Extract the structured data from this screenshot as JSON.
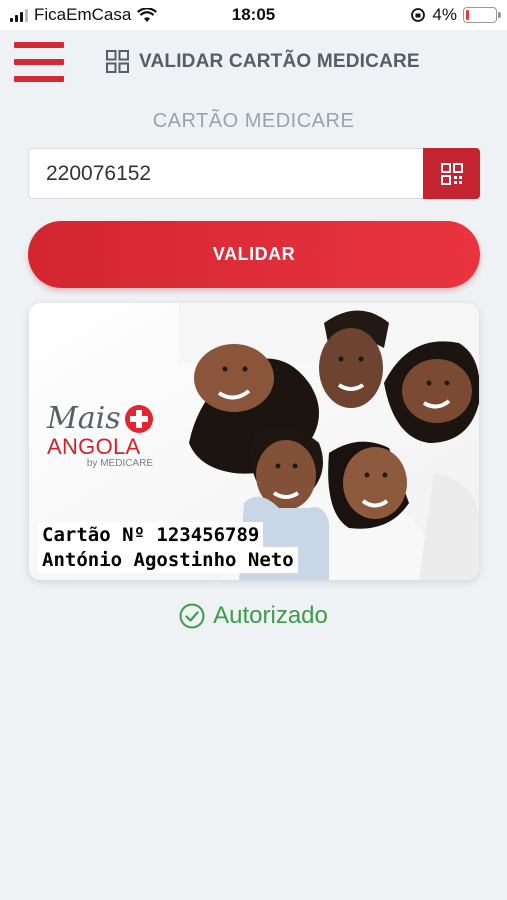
{
  "status_bar": {
    "carrier": "FicaEmCasa",
    "time": "18:05",
    "battery_percent": "4%",
    "battery_level": 0.04
  },
  "header": {
    "title": "VALIDAR CARTÃO MEDICARE",
    "icons": {
      "menu": "hamburger-menu-icon",
      "title": "qr-code-icon"
    }
  },
  "form": {
    "label": "CARTÃO MEDICARE",
    "card_number_value": "220076152",
    "scan_icon": "qr-scan-icon",
    "validate_label": "VALIDAR"
  },
  "card": {
    "brand_line1": "Mais",
    "brand_line2": "ANGOLA",
    "brand_line3": "by MEDICARE",
    "number_text": "Cartão Nº 123456789",
    "holder_text": "António Agostinho Neto"
  },
  "result": {
    "status_label": "Autorizado",
    "status_icon": "check-circle-icon"
  },
  "colors": {
    "primary": "#d32a35",
    "success": "#3f9a4a",
    "background": "#eef2f4"
  }
}
